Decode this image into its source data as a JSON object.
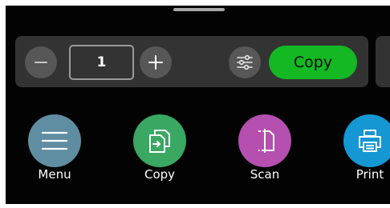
{
  "quick_copy": {
    "quantity": "1",
    "copy_button_label": "Copy"
  },
  "apps": [
    {
      "label": "Menu",
      "icon": "menu-icon",
      "color": "#5f8ea2"
    },
    {
      "label": "Copy",
      "icon": "copy-icon",
      "color": "#3aa763"
    },
    {
      "label": "Scan",
      "icon": "scan-icon",
      "color": "#b54fb0"
    },
    {
      "label": "Print",
      "icon": "printer-icon",
      "color": "#1597d3"
    }
  ],
  "colors": {
    "screen_background": "#030303",
    "control_bar": "#333333",
    "copy_button": "#13b823"
  }
}
